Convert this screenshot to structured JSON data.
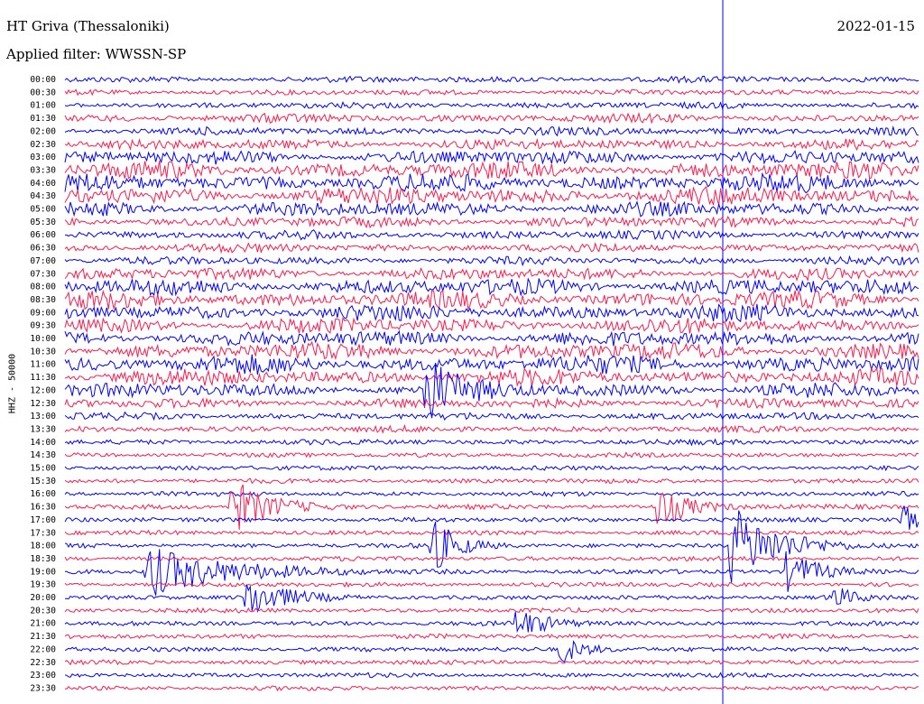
{
  "header": {
    "station": "HT Griva (Thessaloniki)",
    "date": "2022-01-15",
    "filter": "Applied filter: WWSSN-SP"
  },
  "chart_data": {
    "type": "line",
    "title": "HT Griva (Thessaloniki)",
    "ylabel": "HHZ - 50000",
    "xlabel": "",
    "row_labels": [
      "00:00",
      "00:30",
      "01:00",
      "01:30",
      "02:00",
      "02:30",
      "03:00",
      "03:30",
      "04:00",
      "04:30",
      "05:00",
      "05:30",
      "06:00",
      "06:30",
      "07:00",
      "07:30",
      "08:00",
      "08:30",
      "09:00",
      "09:30",
      "10:00",
      "10:30",
      "11:00",
      "11:30",
      "12:00",
      "12:30",
      "13:00",
      "13:30",
      "14:00",
      "14:30",
      "15:00",
      "15:30",
      "16:00",
      "16:30",
      "17:00",
      "17:30",
      "18:00",
      "18:30",
      "19:00",
      "19:30",
      "20:00",
      "20:30",
      "21:00",
      "21:30",
      "22:00",
      "22:30",
      "23:00",
      "23:30"
    ],
    "series_colors": [
      "#0000ff",
      "#ff1a4d"
    ],
    "noise_level_per_row": [
      0.5,
      0.4,
      0.5,
      0.8,
      0.7,
      1.0,
      1.4,
      1.8,
      1.9,
      1.9,
      1.5,
      1.0,
      0.8,
      0.8,
      0.7,
      1.2,
      1.7,
      1.8,
      1.7,
      1.6,
      1.6,
      1.8,
      1.9,
      1.7,
      1.5,
      0.9,
      0.6,
      0.5,
      0.4,
      0.3,
      0.3,
      0.3,
      0.3,
      0.3,
      0.3,
      0.3,
      0.3,
      0.3,
      0.3,
      0.3,
      0.3,
      0.3,
      0.3,
      0.3,
      0.3,
      0.3,
      0.3,
      0.3
    ],
    "events": [
      {
        "row": 36,
        "minute": 23.5,
        "amplitude": 6,
        "duration_min": 1.5
      },
      {
        "row": 38,
        "minute": 3.0,
        "amplitude": 4,
        "duration_min": 2.5
      },
      {
        "row": 40,
        "minute": 6.5,
        "amplitude": 3,
        "duration_min": 1.2
      },
      {
        "row": 24,
        "minute": 12.8,
        "amplitude": 5,
        "duration_min": 0.8
      },
      {
        "row": 33,
        "minute": 6.0,
        "amplitude": 4,
        "duration_min": 1.2
      },
      {
        "row": 36,
        "minute": 13.0,
        "amplitude": 4,
        "duration_min": 0.8
      },
      {
        "row": 33,
        "minute": 21.0,
        "amplitude": 3,
        "duration_min": 1.0
      },
      {
        "row": 38,
        "minute": 25.5,
        "amplitude": 3,
        "duration_min": 1.0
      },
      {
        "row": 42,
        "minute": 16.0,
        "amplitude": 2,
        "duration_min": 1.0
      },
      {
        "row": 44,
        "minute": 17.5,
        "amplitude": 2,
        "duration_min": 0.8
      },
      {
        "row": 40,
        "minute": 27.0,
        "amplitude": 2,
        "duration_min": 0.6
      },
      {
        "row": 34,
        "minute": 29.5,
        "amplitude": 2,
        "duration_min": 0.6
      }
    ]
  }
}
